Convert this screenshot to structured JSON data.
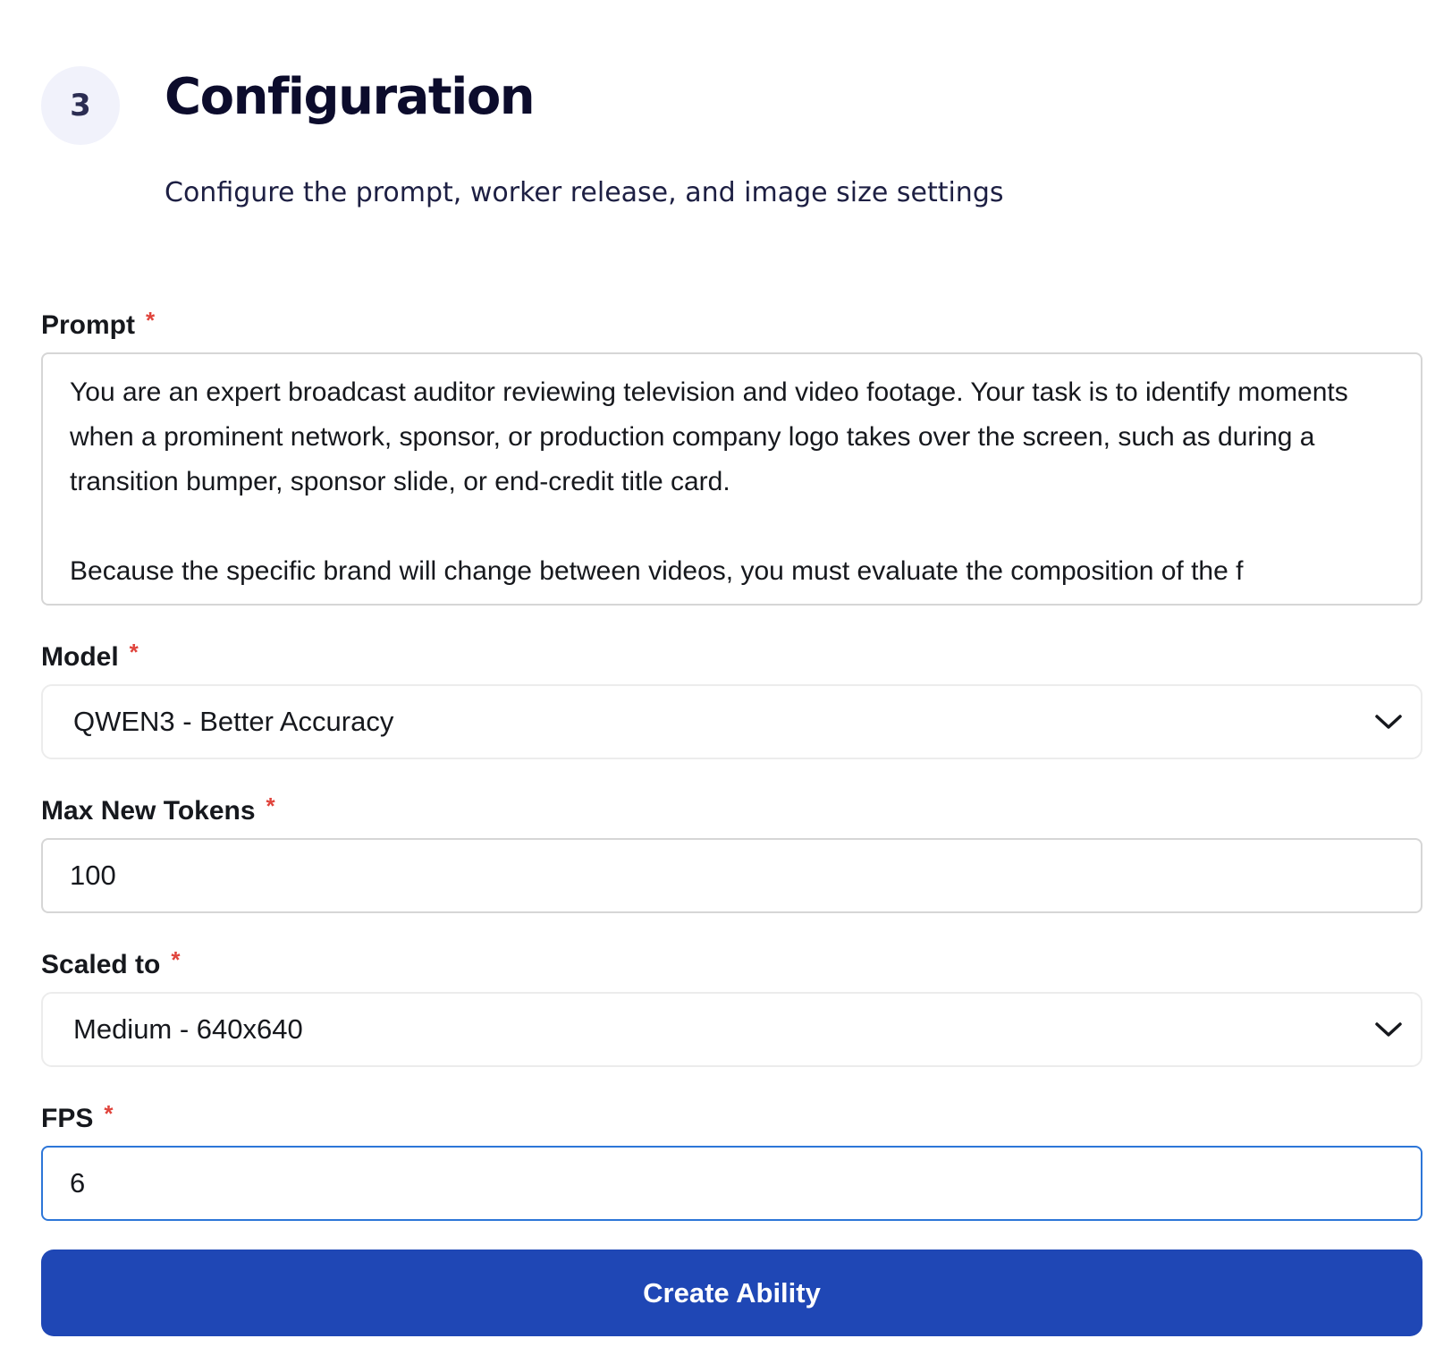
{
  "step": {
    "number": "3",
    "title": "Configuration",
    "description": "Configure the prompt, worker release, and image size settings"
  },
  "form": {
    "required_marker": "*",
    "prompt": {
      "label": "Prompt",
      "value": "You are an expert broadcast auditor reviewing television and video footage. Your task is to identify moments when a prominent network, sponsor, or production company logo takes over the screen, such as during a transition bumper, sponsor slide, or end-credit title card.\n\nBecause the specific brand will change between videos, you must evaluate the composition of the f"
    },
    "model": {
      "label": "Model",
      "selected": "QWEN3 - Better Accuracy"
    },
    "max_new_tokens": {
      "label": "Max New Tokens",
      "value": "100"
    },
    "scaled_to": {
      "label": "Scaled to",
      "selected": "Medium - 640x640"
    },
    "fps": {
      "label": "FPS",
      "value": "6"
    },
    "submit_label": "Create Ability"
  },
  "colors": {
    "primary": "#1f47b5",
    "focus_border": "#2d76d8",
    "required": "#e0443c",
    "step_circle_bg": "#f1f2fb"
  },
  "icons": {
    "select_chevron": "chevron-down-icon"
  }
}
